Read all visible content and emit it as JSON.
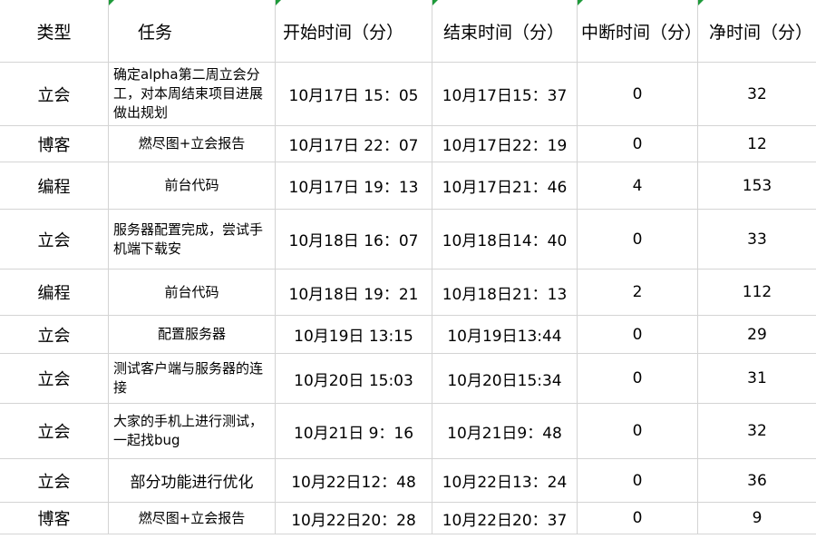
{
  "headers": [
    "类型",
    "任务",
    "开始时间（分）",
    "结束时间（分）",
    "中断时间（分）",
    "净时间（分）"
  ],
  "rows": [
    {
      "type": "立会",
      "task": "确定alpha第二周立会分工，对本周结束项目进展做出规划",
      "start": "10月17日 15：05",
      "end": "10月17日15：37",
      "interrupt": "0",
      "net": "32"
    },
    {
      "type": "博客",
      "task": "燃尽图+立会报告",
      "start": "10月17日 22：07",
      "end": "10月17日22：19",
      "interrupt": "0",
      "net": "12"
    },
    {
      "type": "编程",
      "task": "前台代码",
      "start": "10月17日 19：13",
      "end": "10月17日21：46",
      "interrupt": "4",
      "net": "153"
    },
    {
      "type": "立会",
      "task": "服务器配置完成，尝试手机端下载安",
      "start": "10月18日 16：07",
      "end": "10月18日14：40",
      "interrupt": "0",
      "net": "33"
    },
    {
      "type": "编程",
      "task": "前台代码",
      "start": "10月18日 19：21",
      "end": "10月18日21：13",
      "interrupt": "2",
      "net": "112"
    },
    {
      "type": "立会",
      "task": "配置服务器",
      "start": "10月19日 13:15",
      "end": "10月19日13:44",
      "interrupt": "0",
      "net": "29"
    },
    {
      "type": "立会",
      "task": "测试客户端与服务器的连接",
      "start": "10月20日 15:03",
      "end": "10月20日15:34",
      "interrupt": "0",
      "net": "31"
    },
    {
      "type": "立会",
      "task": "大家的手机上进行测试，一起找bug",
      "start": "10月21日 9：16",
      "end": "10月21日9：48",
      "interrupt": "0",
      "net": "32"
    },
    {
      "type": "立会",
      "task": "部分功能进行优化",
      "start": "10月22日12：48",
      "end": "10月22日13：24",
      "interrupt": "0",
      "net": "36"
    },
    {
      "type": "博客",
      "task": "燃尽图+立会报告",
      "start": "10月22日20：28",
      "end": "10月22日20：37",
      "interrupt": "0",
      "net": "9"
    }
  ],
  "accent_color": "#1e9a3a"
}
